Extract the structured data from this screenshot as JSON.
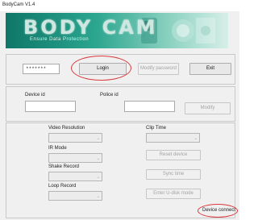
{
  "window": {
    "title": "BodyCam V1.4"
  },
  "banner": {
    "title": "BODY CAM",
    "subtitle": "Ensure Data Protection"
  },
  "login": {
    "password_value": "*******",
    "login_label": "Login",
    "modify_password_label": "Modify password",
    "exit_label": "Exit"
  },
  "ids": {
    "device_id_label": "Device id",
    "police_id_label": "Police id",
    "device_id_value": "",
    "police_id_value": "",
    "modify_label": "Modify"
  },
  "settings": {
    "video_resolution_label": "Video Resolution",
    "ir_mode_label": "IR Mode",
    "shake_record_label": "Shake Record",
    "loop_record_label": "Loop Record",
    "clip_time_label": "Clip Time",
    "reset_device_label": "Reset device",
    "sync_time_label": "Sync time",
    "enter_udisk_label": "Enter U-disk mode",
    "dropdown_arrow": "⌄"
  },
  "status": {
    "device_connect_label": "Device connect"
  },
  "colors": {
    "annotation": "#d9393e",
    "banner": "#1e8f7c"
  }
}
